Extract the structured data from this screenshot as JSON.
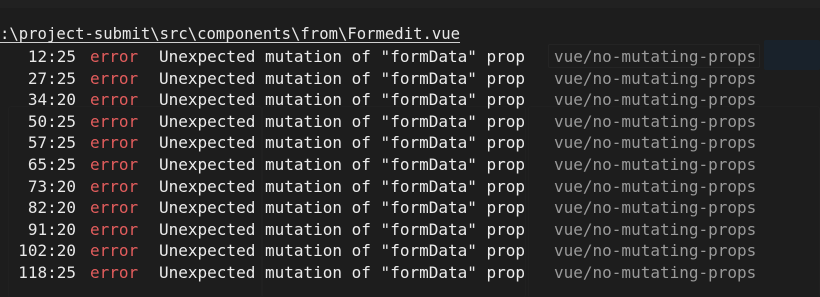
{
  "colors": {
    "overlay_bg": "#181818",
    "text": "#ececec",
    "severity_error": "#e35d5d",
    "rule": "#9a9a9a"
  },
  "file_path": ":\\project-submit\\src\\components\\from\\Formedit.vue",
  "errors": [
    {
      "location": "12:25",
      "severity": "error",
      "message": "Unexpected mutation of \"formData\" prop",
      "rule": "vue/no-mutating-props"
    },
    {
      "location": "27:25",
      "severity": "error",
      "message": "Unexpected mutation of \"formData\" prop",
      "rule": "vue/no-mutating-props"
    },
    {
      "location": "34:20",
      "severity": "error",
      "message": "Unexpected mutation of \"formData\" prop",
      "rule": "vue/no-mutating-props"
    },
    {
      "location": "50:25",
      "severity": "error",
      "message": "Unexpected mutation of \"formData\" prop",
      "rule": "vue/no-mutating-props"
    },
    {
      "location": "57:25",
      "severity": "error",
      "message": "Unexpected mutation of \"formData\" prop",
      "rule": "vue/no-mutating-props"
    },
    {
      "location": "65:25",
      "severity": "error",
      "message": "Unexpected mutation of \"formData\" prop",
      "rule": "vue/no-mutating-props"
    },
    {
      "location": "73:20",
      "severity": "error",
      "message": "Unexpected mutation of \"formData\" prop",
      "rule": "vue/no-mutating-props"
    },
    {
      "location": "82:20",
      "severity": "error",
      "message": "Unexpected mutation of \"formData\" prop",
      "rule": "vue/no-mutating-props"
    },
    {
      "location": "91:20",
      "severity": "error",
      "message": "Unexpected mutation of \"formData\" prop",
      "rule": "vue/no-mutating-props"
    },
    {
      "location": "102:20",
      "severity": "error",
      "message": "Unexpected mutation of \"formData\" prop",
      "rule": "vue/no-mutating-props"
    },
    {
      "location": "118:25",
      "severity": "error",
      "message": "Unexpected mutation of \"formData\" prop",
      "rule": "vue/no-mutating-props"
    }
  ]
}
